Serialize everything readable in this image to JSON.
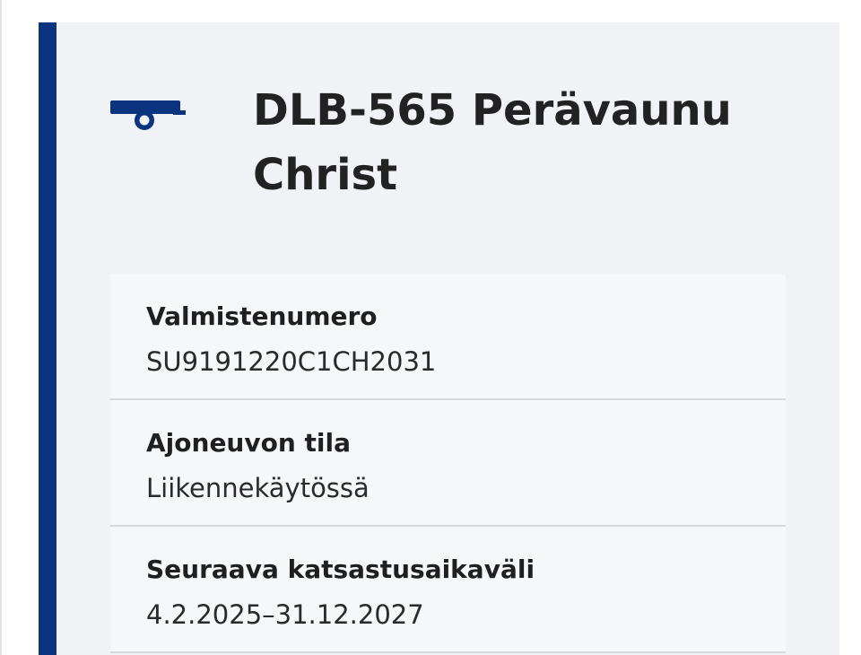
{
  "vehicle": {
    "icon": "trailer-icon",
    "title_line1": "DLB-565 Perävaunu",
    "title_line2": "Christ"
  },
  "details": [
    {
      "label": "Valmistenumero",
      "value": "SU9191220C1CH2031"
    },
    {
      "label": "Ajoneuvon tila",
      "value": "Liikennekäytössä"
    },
    {
      "label": "Seuraava katsastusaikaväli",
      "value": "4.2.2025–31.12.2027"
    }
  ],
  "colors": {
    "accent": "#0a3380",
    "card_background": "#f1f2f6",
    "row_background": "#f6f7f9",
    "divider": "#d6d8dc"
  }
}
